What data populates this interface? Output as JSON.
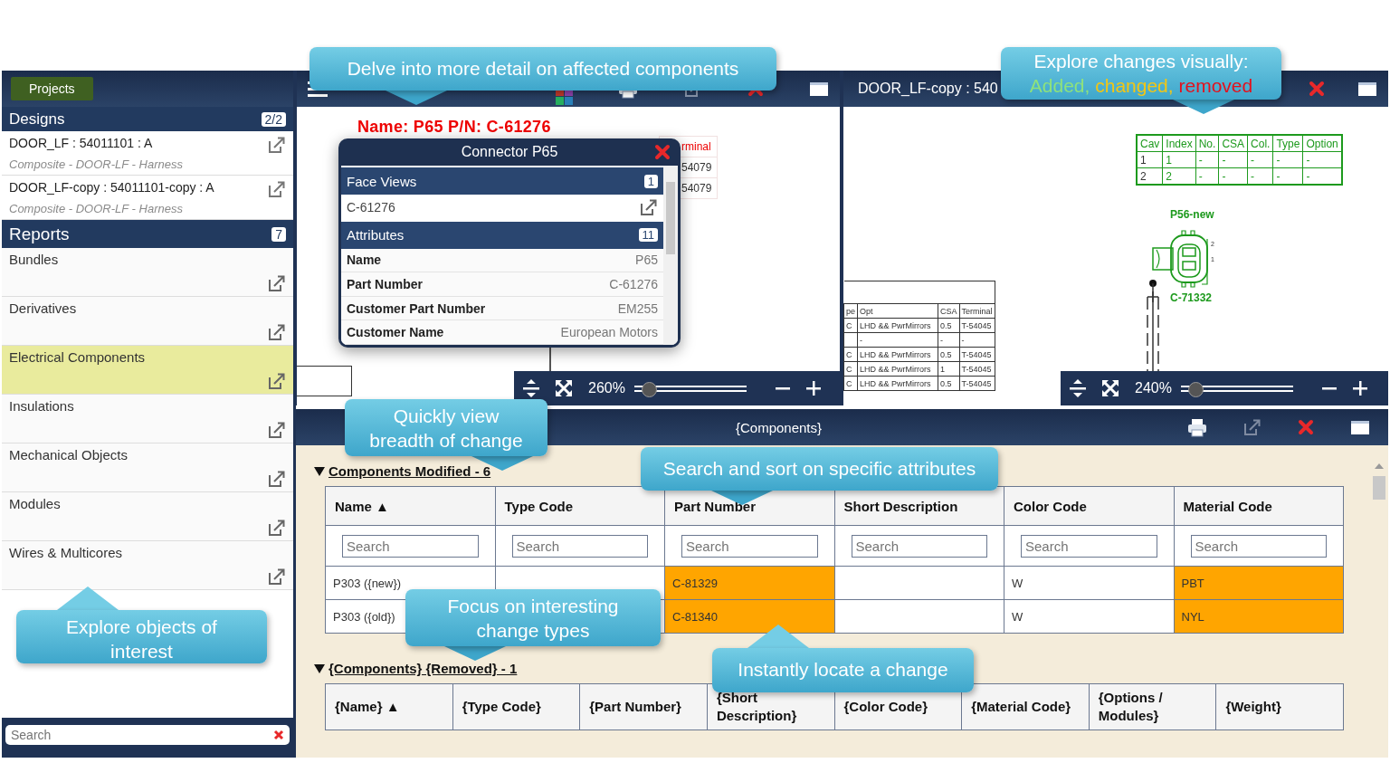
{
  "sidebar": {
    "projects_button": "Projects",
    "designs": {
      "title": "Designs",
      "count": "2/2",
      "items": [
        {
          "name": "DOOR_LF : 54011101 : A",
          "subtitle": "Composite - DOOR-LF - Harness"
        },
        {
          "name": "DOOR_LF-copy : 54011101-copy : A",
          "subtitle": "Composite - DOOR-LF - Harness"
        }
      ]
    },
    "reports": {
      "title": "Reports",
      "count": "7",
      "items": [
        {
          "label": "Bundles",
          "selected": false
        },
        {
          "label": "Derivatives",
          "selected": false
        },
        {
          "label": "Electrical Components",
          "selected": true
        },
        {
          "label": "Insulations",
          "selected": false
        },
        {
          "label": "Mechanical Objects",
          "selected": false
        },
        {
          "label": "Modules",
          "selected": false
        },
        {
          "label": "Wires & Multicores",
          "selected": false
        }
      ]
    },
    "search": {
      "placeholder": "Search"
    }
  },
  "left_pane": {
    "diagram_label": "Name: P65 P/N: C-61276",
    "background_cells": [
      "rminal",
      "54079",
      "54079"
    ],
    "popup": {
      "title": "Connector P65",
      "sections": [
        {
          "title": "Face Views",
          "count": "1",
          "rows": [
            {
              "kind": "link",
              "label": "C-61276"
            }
          ]
        },
        {
          "title": "Attributes",
          "count": "11",
          "rows": [
            {
              "kind": "attribute",
              "label": "Name",
              "value": "P65"
            },
            {
              "kind": "attribute",
              "label": "Part Number",
              "value": "C-61276"
            },
            {
              "kind": "attribute",
              "label": "Customer Part Number",
              "value": "EM255"
            },
            {
              "kind": "attribute",
              "label": "Customer Name",
              "value": "European Motors"
            }
          ]
        }
      ]
    },
    "zoom": {
      "reading": "260%",
      "level": 0.08
    }
  },
  "right_pane": {
    "title": "DOOR_LF-copy : 540",
    "cavity_table": {
      "columns": [
        "Cav",
        "Index",
        "No.",
        "CSA",
        "Col.",
        "Type",
        "Option"
      ],
      "rows": [
        [
          "1",
          "1",
          "-",
          "-",
          "-",
          "-",
          "-"
        ],
        [
          "2",
          "2",
          "-",
          "-",
          "-",
          "-",
          "-"
        ]
      ]
    },
    "connector_name": "P56-new",
    "connector_part": "C-71332",
    "pin_labels": [
      "2",
      "1"
    ],
    "wire_table": {
      "columns": [
        "pe",
        "Opt",
        "CSA",
        "Terminal"
      ],
      "rows": [
        [
          "C",
          "LHD && PwrMirrors",
          "0.5",
          "T-54045"
        ],
        [
          null,
          "-",
          "-",
          "-"
        ],
        [
          "C",
          "LHD && PwrMirrors",
          "0.5",
          "T-54045"
        ],
        [
          "C",
          "LHD && PwrMirrors",
          "1",
          "T-54045"
        ],
        [
          "C",
          "LHD && PwrMirrors",
          "0.5",
          "T-54045"
        ]
      ]
    },
    "zoom": {
      "reading": "240%",
      "level": 0.08
    }
  },
  "components_pane": {
    "title": "{Components}",
    "sections": [
      {
        "title": "Components Modified - 6",
        "expanded": true,
        "search_placeholders": [
          "Search",
          "Search",
          "Search",
          "Search",
          "Search",
          "Search"
        ],
        "columns": [
          "Name ▲",
          "Type Code",
          "Part Number",
          "Short Description",
          "Color Code",
          "Material Code"
        ],
        "rows": [
          {
            "cells": [
              {
                "text": "P303 ({new})",
                "changed": false
              },
              {},
              {
                "text": "C-81329",
                "changed": true
              },
              {},
              {
                "text": "W",
                "changed": false
              },
              {
                "text": "PBT",
                "changed": true
              }
            ]
          },
          {
            "cells": [
              {
                "text": "P303 ({old})",
                "changed": false
              },
              {},
              {
                "text": "C-81340",
                "changed": true
              },
              {},
              {
                "text": "W",
                "changed": false
              },
              {
                "text": "NYL",
                "changed": true
              }
            ]
          }
        ]
      },
      {
        "title": "{Components} {Removed} - 1",
        "expanded": true,
        "columns": [
          "{Name} ▲",
          "{Type Code}",
          "{Part Number}",
          "{Short Description}",
          "{Color Code}",
          "{Material Code}",
          "{Options / Modules}",
          "{Weight}"
        ]
      }
    ]
  },
  "callouts": [
    {
      "kind": "plain",
      "lines": [
        "Delve into more detail on affected components"
      ]
    },
    {
      "kind": "legend",
      "lines": [
        "Explore changes visually:"
      ],
      "legend": [
        {
          "text": "Added,",
          "color": "#8ee27c"
        },
        {
          "text": "changed,",
          "color": "#f3c613"
        },
        {
          "text": "removed",
          "color": "#e4101c"
        }
      ]
    },
    {
      "kind": "plain",
      "lines": [
        "Quickly view",
        "breadth of change"
      ]
    },
    {
      "kind": "plain",
      "lines": [
        "Search and sort on specific attributes"
      ]
    },
    {
      "kind": "plain",
      "lines": [
        "Focus on interesting",
        "change types"
      ]
    },
    {
      "kind": "plain",
      "lines": [
        "Instantly locate a change"
      ]
    },
    {
      "kind": "plain",
      "lines": [
        "Explore objects of",
        "interest"
      ]
    }
  ]
}
